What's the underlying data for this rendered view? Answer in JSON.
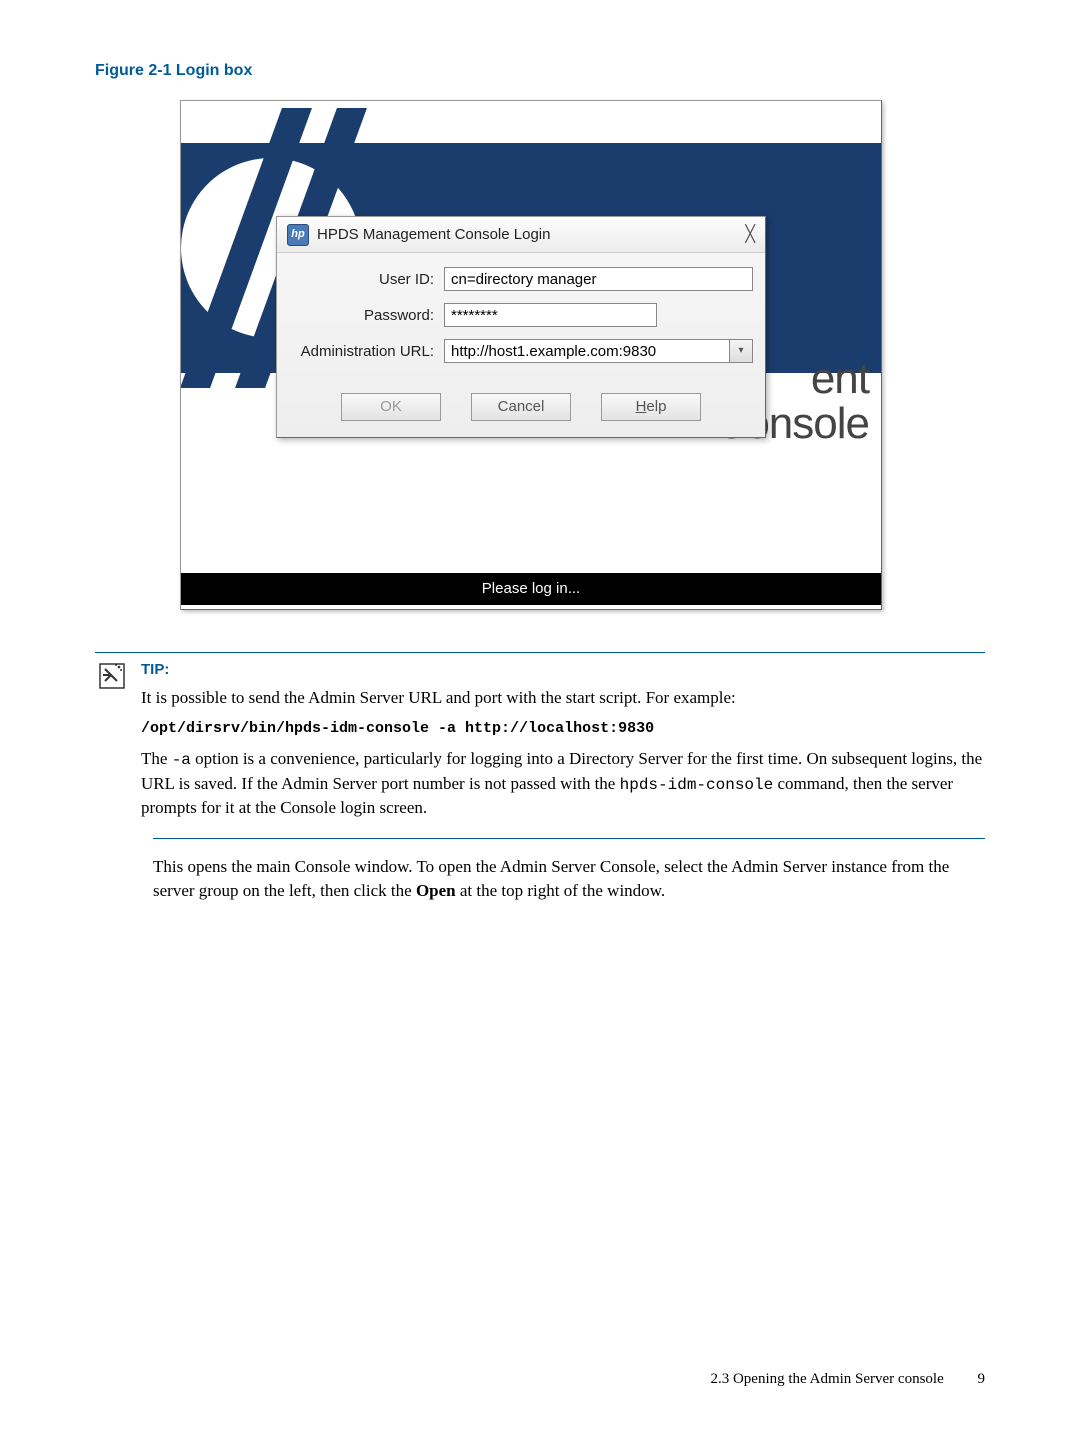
{
  "figure": {
    "caption": "Figure 2-1 Login box"
  },
  "screenshot": {
    "bg_text_partial": "ent",
    "bg_text_console": "Console",
    "status": "Please log in..."
  },
  "login_dialog": {
    "icon_text": "hp",
    "title": "HPDS Management Console Login",
    "close_glyph": "╳",
    "labels": {
      "user_id": "User ID:",
      "password": "Password:",
      "admin_url": "Administration URL:"
    },
    "values": {
      "user_id": "cn=directory manager",
      "password": "********",
      "admin_url": "http://host1.example.com:9830"
    },
    "buttons": {
      "ok": "OK",
      "cancel": "Cancel",
      "help_pre": "H",
      "help_rest": "elp"
    },
    "dropdown_glyph": "▾"
  },
  "tip": {
    "label": "TIP:",
    "p1": "It is possible to send the Admin Server URL and port with the start script. For example:",
    "cmd": "/opt/dirsrv/bin/hpds-idm-console -a http://localhost:9830",
    "p2a": "The ",
    "p2b": "-a",
    "p2c": " option is a convenience, particularly for logging into a Directory Server for the first time. On subsequent logins, the URL is saved. If the Admin Server port number is not passed with the ",
    "p2d": "hpds-idm-console",
    "p2e": " command, then the server prompts for it at the Console login screen."
  },
  "body": {
    "p1a": "This opens the main Console window. To open the Admin Server Console, select the Admin Server instance from the server group on the left, then click the ",
    "p1b": "Open",
    "p1c": " at the top right of the window."
  },
  "footer": {
    "section": "2.3 Opening the Admin Server console",
    "page": "9"
  }
}
